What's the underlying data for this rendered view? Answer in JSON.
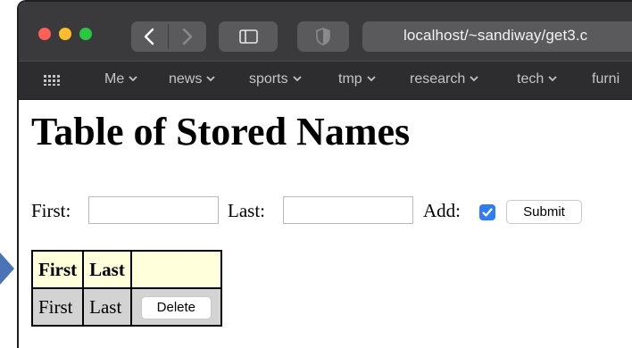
{
  "browser": {
    "url": "localhost/~sandiway/get3.c",
    "bookmarks": [
      "Me",
      "news",
      "sports",
      "tmp",
      "research",
      "tech",
      "furni"
    ],
    "icons": {
      "close": "red-dot",
      "minimize": "yellow-dot",
      "zoom": "green-dot",
      "back": "chevron-left-icon",
      "forward": "chevron-right-icon",
      "sidebar": "sidebar-icon",
      "privacy": "shield-icon",
      "favorites": "grid-icon"
    }
  },
  "page": {
    "title": "Table of Stored Names",
    "form": {
      "first_label": "First:",
      "first_value": "",
      "last_label": "Last:",
      "last_value": "",
      "add_label": "Add:",
      "add_checked": true,
      "submit_label": "Submit"
    },
    "table": {
      "headers": [
        "First",
        "Last",
        ""
      ],
      "rows": [
        {
          "first": "First",
          "last": "Last",
          "action": "Delete"
        }
      ]
    }
  },
  "colors": {
    "toolbar": "#3a3a3c",
    "bookmarks_bar": "#2d2d2f",
    "table_header_bg": "#ffffdc",
    "table_row_bg": "#d3d3d3",
    "checkbox": "#2f7cf6",
    "pointer": "#4a74b6"
  }
}
